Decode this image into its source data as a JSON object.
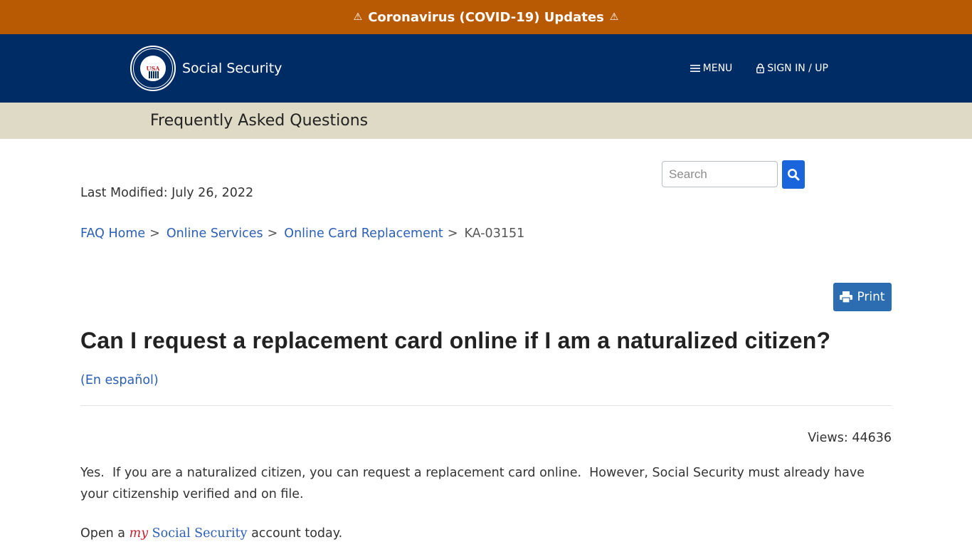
{
  "alert": {
    "text": "Coronavirus (COVID-19) Updates",
    "icon": "warning-triangle-icon",
    "color": "#b85a04"
  },
  "header": {
    "logo_seal_text": "USA",
    "logo_text": "Social Security",
    "menu_label": "MENU",
    "signin_label": "SIGN IN / UP",
    "color": "#002c66"
  },
  "subheader": {
    "title": "Frequently Asked Questions"
  },
  "search": {
    "placeholder": "Search",
    "value": ""
  },
  "page": {
    "last_modified": "Last Modified: July 26, 2022",
    "breadcrumb": [
      {
        "label": "FAQ Home"
      },
      {
        "label": "Online Services"
      },
      {
        "label": "Online Card Replacement"
      }
    ],
    "breadcrumb_sep": ">",
    "breadcrumb_current": "KA-03151",
    "print_label": "Print",
    "title": "Can I request a replacement card online if I am a naturalized citizen?",
    "espanol_link": "(En español)",
    "views": "Views: 44636",
    "answer": "Yes.  If you are a naturalized citizen, you can request a replacement card online.  However, Social Security must already have your citizenship verified and on file.",
    "cta_prefix": "Open a",
    "cta_my": "my",
    "cta_ss": "Social Security",
    "cta_suffix": "account today."
  }
}
